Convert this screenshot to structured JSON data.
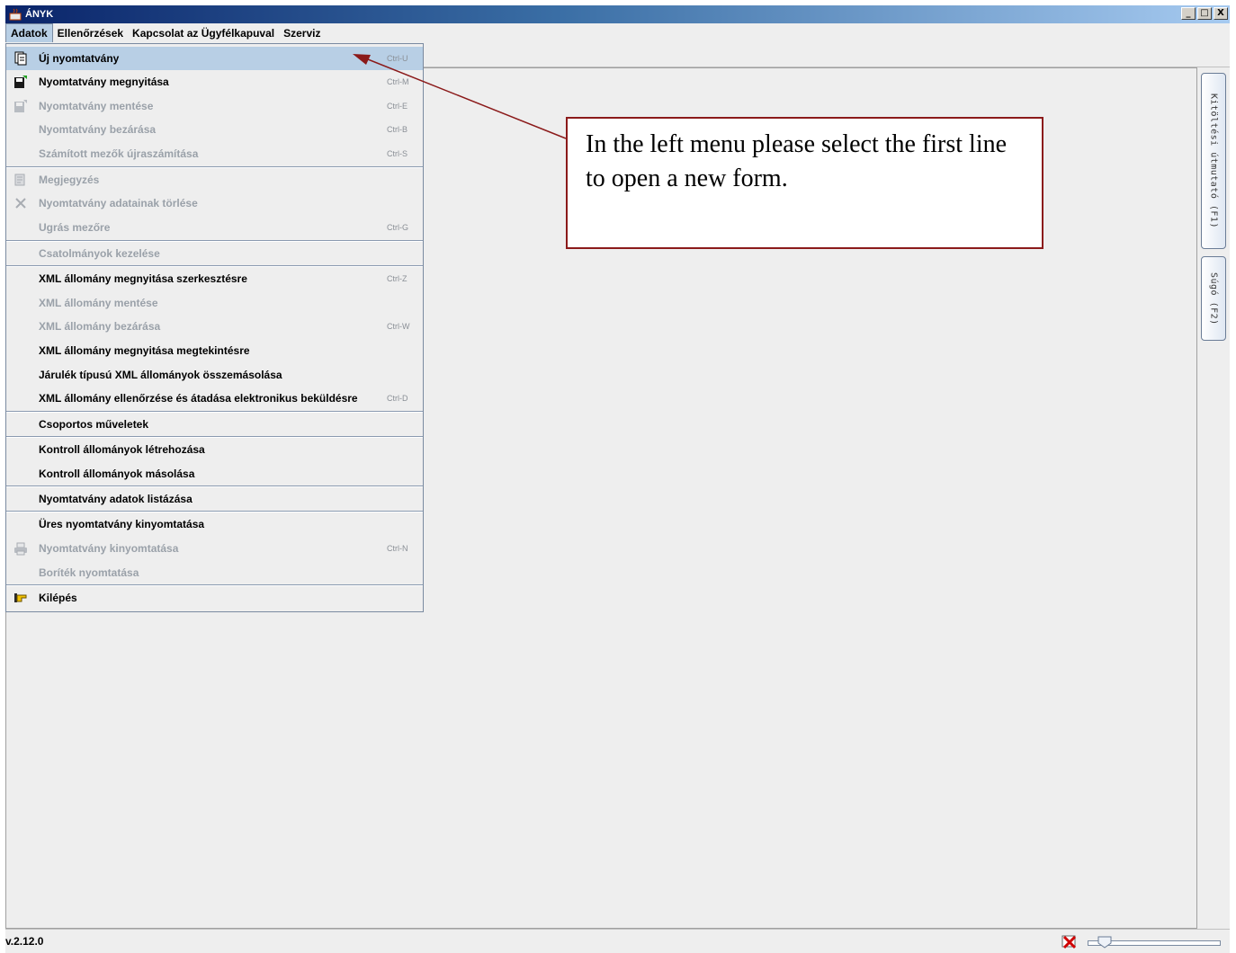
{
  "window": {
    "title": "ÁNYK",
    "minimize": "_",
    "maximize": "□",
    "close": "X"
  },
  "menubar": {
    "items": [
      "Adatok",
      "Ellenőrzések",
      "Kapcsolat az Ügyfélkapuval",
      "Szerviz"
    ]
  },
  "dropdown": {
    "items": [
      {
        "label": "Új nyomtatvány",
        "shortcut": "Ctrl-U",
        "icon": "new-form-icon",
        "enabled": true,
        "selected": true
      },
      {
        "label": "Nyomtatvány megnyitása",
        "shortcut": "Ctrl-M",
        "icon": "open-form-icon",
        "enabled": true
      },
      {
        "label": "Nyomtatvány mentése",
        "shortcut": "Ctrl-E",
        "icon": "save-form-icon",
        "enabled": false
      },
      {
        "label": "Nyomtatvány bezárása",
        "shortcut": "Ctrl-B",
        "enabled": false
      },
      {
        "label": "Számított mezők újraszámítása",
        "shortcut": "Ctrl-S",
        "enabled": false
      },
      {
        "label": "Megjegyzés",
        "shortcut": "",
        "icon": "note-icon",
        "enabled": false
      },
      {
        "label": "Nyomtatvány adatainak törlése",
        "shortcut": "",
        "icon": "delete-icon",
        "enabled": false
      },
      {
        "label": "Ugrás mezőre",
        "shortcut": "Ctrl-G",
        "enabled": false
      },
      {
        "label": "Csatolmányok kezelése",
        "shortcut": "",
        "enabled": false
      },
      {
        "label": "XML állomány megnyitása szerkesztésre",
        "shortcut": "Ctrl-Z",
        "enabled": true
      },
      {
        "label": "XML állomány mentése",
        "shortcut": "",
        "enabled": false
      },
      {
        "label": "XML állomány bezárása",
        "shortcut": "Ctrl-W",
        "enabled": false
      },
      {
        "label": "XML állomány megnyitása megtekintésre",
        "shortcut": "",
        "enabled": true
      },
      {
        "label": "Járulék típusú XML állományok összemásolása",
        "shortcut": "",
        "enabled": true
      },
      {
        "label": "XML állomány ellenőrzése és átadása elektronikus beküldésre",
        "shortcut": "Ctrl-D",
        "enabled": true
      },
      {
        "label": "Csoportos műveletek",
        "shortcut": "",
        "enabled": true
      },
      {
        "label": "Kontroll állományok létrehozása",
        "shortcut": "",
        "enabled": true
      },
      {
        "label": "Kontroll állományok másolása",
        "shortcut": "",
        "enabled": true
      },
      {
        "label": "Nyomtatvány adatok listázása",
        "shortcut": "",
        "enabled": true
      },
      {
        "label": "Üres nyomtatvány kinyomtatása",
        "shortcut": "",
        "enabled": true
      },
      {
        "label": "Nyomtatvány kinyomtatása",
        "shortcut": "Ctrl-N",
        "icon": "printer-icon",
        "enabled": false
      },
      {
        "label": "Boríték nyomtatása",
        "shortcut": "",
        "enabled": false
      },
      {
        "label": "Kilépés",
        "shortcut": "",
        "icon": "exit-hand-icon",
        "enabled": true
      }
    ]
  },
  "side_tabs": [
    "Kitöltési útmutató (F1)",
    "Súgó (F2)"
  ],
  "callout": {
    "text": "In the left menu please select the first line to open a new form.",
    "color": "#8b1a1a"
  },
  "status": {
    "version": "v.2.12.0"
  },
  "colors": {
    "selection": "#b8cfe5",
    "disabled_text": "#9aa1a9",
    "background": "#eeeeee"
  }
}
